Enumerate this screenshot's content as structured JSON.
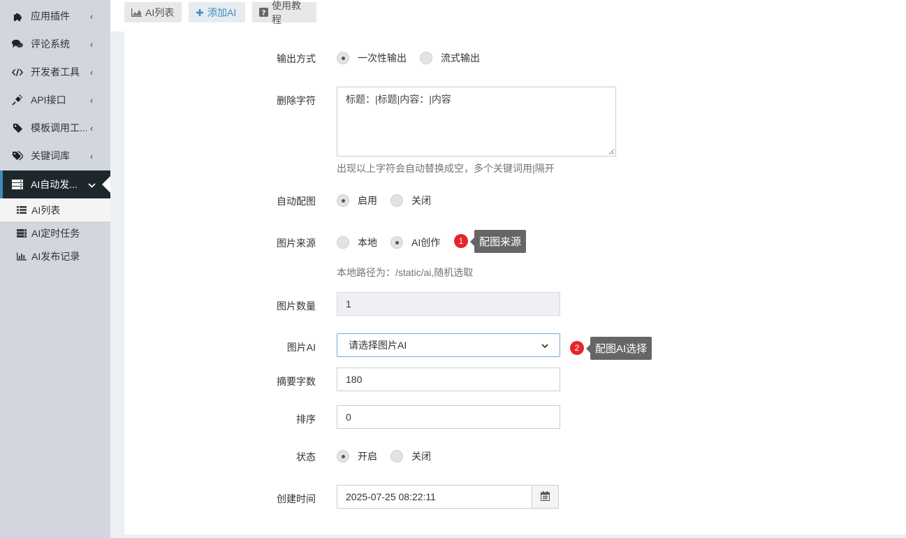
{
  "sidebar": {
    "items": [
      {
        "icon": "puzzle-icon",
        "label": "应用插件"
      },
      {
        "icon": "comments-icon",
        "label": "评论系统"
      },
      {
        "icon": "code-icon",
        "label": "开发者工具"
      },
      {
        "icon": "plug-icon",
        "label": "API接口"
      },
      {
        "icon": "tag-icon",
        "label": "模板调用工..."
      },
      {
        "icon": "tags-icon",
        "label": "关键词库"
      },
      {
        "icon": "server-icon",
        "label": "AI自动发..."
      }
    ],
    "submenu": [
      {
        "icon": "list-icon",
        "label": "AI列表"
      },
      {
        "icon": "tasks-icon",
        "label": "AI定时任务"
      },
      {
        "icon": "bar-chart-icon",
        "label": "AI发布记录"
      }
    ]
  },
  "toolbar": {
    "list_label": "AI列表",
    "add_label": "添加AI",
    "tutorial_label": "使用教程"
  },
  "form": {
    "output_mode": {
      "label": "输出方式",
      "options": [
        "一次性输出",
        "流式输出"
      ],
      "selected": "一次性输出"
    },
    "delete_chars": {
      "label": "删除字符",
      "value": "标题：|标题|内容：|内容",
      "help": "出现以上字符会自动替换成空，多个关键词用|隔开"
    },
    "auto_image": {
      "label": "自动配图",
      "options": [
        "启用",
        "关闭"
      ],
      "selected": "启用"
    },
    "image_source": {
      "label": "图片来源",
      "options": [
        "本地",
        "AI创作"
      ],
      "selected": "AI创作",
      "help": "本地路径为：/static/ai,随机选取"
    },
    "image_count": {
      "label": "图片数量",
      "value": "1"
    },
    "image_ai": {
      "label": "图片AI",
      "value": "请选择图片AI"
    },
    "summary_chars": {
      "label": "摘要字数",
      "value": "180"
    },
    "sort": {
      "label": "排序",
      "value": "0"
    },
    "status": {
      "label": "状态",
      "options": [
        "开启",
        "关闭"
      ],
      "selected": "开启"
    },
    "created_at": {
      "label": "创建时间",
      "value": "2025-07-25 08:22:11"
    }
  },
  "annotations": [
    {
      "number": "1",
      "text": "配图来源"
    },
    {
      "number": "2",
      "text": "配图AI选择"
    }
  ],
  "colors": {
    "sidebar_bg": "#d2d6de",
    "active_bg": "#1e282c",
    "accent": "#3c8dbc",
    "badge": "#e8242b",
    "tooltip": "#666666"
  }
}
